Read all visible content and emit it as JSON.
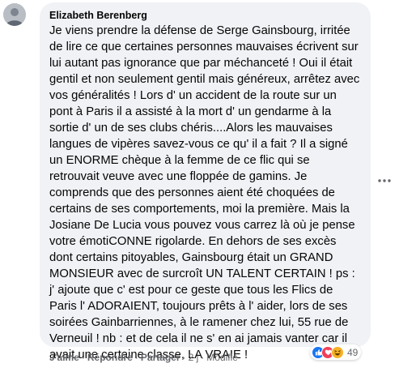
{
  "comment": {
    "author": "Elizabeth Berenberg",
    "text": "Je viens prendre la défense de Serge Gainsbourg, irritée de lire ce que certaines personnes mauvaises écrivent sur lui autant pas ignorance que par méchanceté ! Oui il était gentil et non seulement gentil mais généreux, arrêtez avec vos généralités ! Lors d' un accident de la route sur un pont à Paris il a assisté à la mort d' un gendarme à la sortie d' un de ses clubs chéris....Alors les mauvaises langues de vipères savez-vous ce qu' il a fait ? Il a signé un ENORME chèque à la femme de ce flic qui se retrouvait veuve avec une floppée de gamins. Je comprends que des personnes aient été choquées de certains de ses comportements, moi la première. Mais la Josiane De Lucia vous pouvez vous carrez là où je pense votre émotiCONNE rigolarde. En dehors de ses excès dont certains pitoyables, Gainsbourg était un GRAND MONSIEUR avec de surcroît UN TALENT CERTAIN ! ps : j' ajoute que c' est pour ce geste que tous les Flics de Paris l' ADORAIENT, toujours prêts à l' aider, lors de ses soirées Gainbarriennes, à le ramener chez lui, 55 rue de Verneuil ! nb : et de cela il ne s' en ai jamais vanter car il avait une certaine classe, LA VRAIE !"
  },
  "actions": {
    "like": "J'aime",
    "reply": "Répondre",
    "share": "Partager",
    "separator": "·",
    "time": "2 j",
    "edited": "Modifié"
  },
  "reactions": {
    "icons": [
      "like-icon",
      "love-icon",
      "haha-icon"
    ],
    "count": "49",
    "colors": {
      "like": "#1877f2",
      "love": "#f33e58",
      "haha": "#f7b125"
    }
  },
  "colors": {
    "bubble": "#f0f2f5",
    "text": "#050505",
    "secondary": "#65676b"
  }
}
